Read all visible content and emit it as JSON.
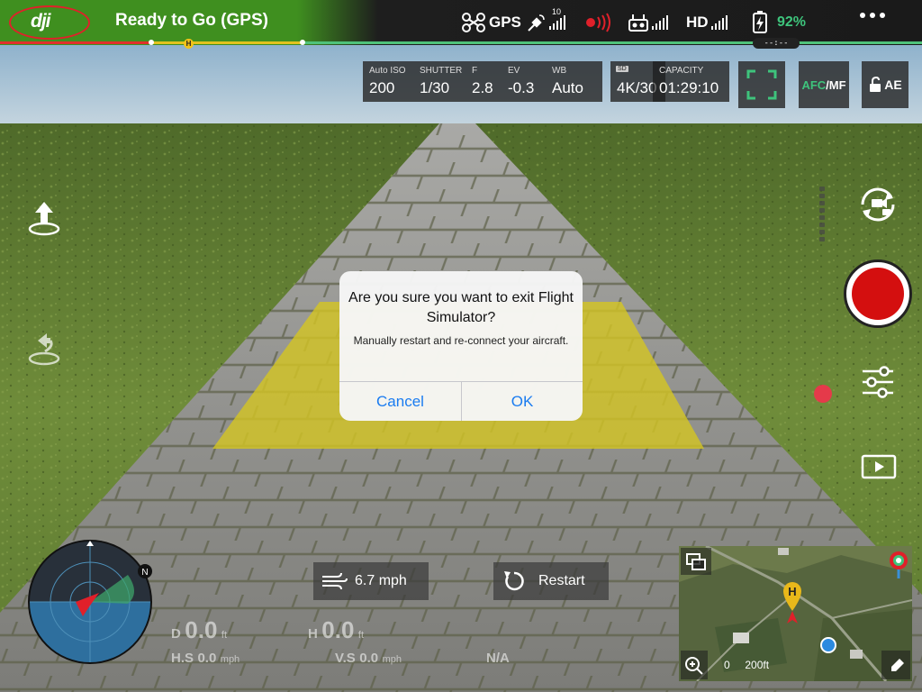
{
  "status_bar": {
    "logo": "dji",
    "status_text": "Ready to Go (GPS)",
    "gps_label": "GPS",
    "satellite_count": "10",
    "hd_label": "HD",
    "battery_percent": "92%",
    "gimbal_indicator": "--:--",
    "home_marker": "H",
    "icons": [
      "aircraft-gps-icon",
      "satellite-icon",
      "obstacle-sensing-icon",
      "remote-controller-icon",
      "hd-signal-icon",
      "battery-icon",
      "more-icon"
    ],
    "colors": {
      "ready": "#3f8f1f",
      "battery": "#3ec47c"
    }
  },
  "camera_settings": {
    "iso_label": "Auto ISO",
    "iso_value": "200",
    "shutter_label": "SHUTTER",
    "shutter_value": "1/30",
    "f_label": "F",
    "f_value": "2.8",
    "ev_label": "EV",
    "ev_value": "-0.3",
    "wb_label": "WB",
    "wb_value": "Auto",
    "sd_badge": "SD",
    "resolution": "4K/30",
    "capacity_label": "CAPACITY",
    "capacity_value": "01:29:10",
    "afc_label": "AFC",
    "mf_label": "/MF",
    "ae_label": "AE"
  },
  "dialog": {
    "title": "Are you sure you want to exit Flight Simulator?",
    "message": "Manually restart and re-connect your aircraft.",
    "cancel_label": "Cancel",
    "ok_label": "OK"
  },
  "bottom": {
    "wind_speed": "6.7 mph",
    "restart_label": "Restart"
  },
  "telemetry": {
    "d_label": "D",
    "d_value": "0.0",
    "d_unit": "ft",
    "h_label": "H",
    "h_value": "0.0",
    "h_unit": "ft",
    "hs_label": "H.S",
    "hs_value": "0.0",
    "hs_unit": "mph",
    "vs_label": "V.S",
    "vs_value": "0.0",
    "vs_unit": "mph",
    "vps_value": "N/A"
  },
  "radar": {
    "north_label": "N"
  },
  "map": {
    "scale_zero": "0",
    "scale_value": "200ft",
    "home_marker": "H"
  }
}
